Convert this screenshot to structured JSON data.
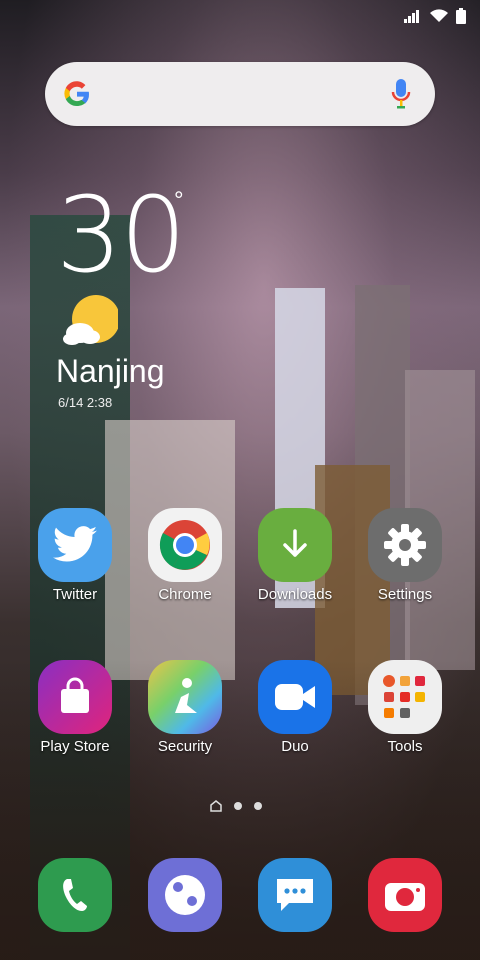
{
  "weather": {
    "temperature": "30",
    "degree_symbol": "°",
    "city": "Nanjing",
    "updated": "6/14 2:38"
  },
  "apps_row1": [
    {
      "label": "Twitter",
      "icon": "twitter-icon",
      "color": "#4aa1eb"
    },
    {
      "label": "Chrome",
      "icon": "chrome-icon",
      "color": "#f2f2f2"
    },
    {
      "label": "Downloads",
      "icon": "download-icon",
      "color": "#69ae3f"
    },
    {
      "label": "Settings",
      "icon": "gear-icon",
      "color": "#6d6d6d"
    }
  ],
  "apps_row2": [
    {
      "label": "Play Store",
      "icon": "shopping-bag-icon",
      "color": "#c6248c"
    },
    {
      "label": "Security",
      "icon": "security-icon",
      "color": "#56c5e8"
    },
    {
      "label": "Duo",
      "icon": "video-camera-icon",
      "color": "#1a73e8"
    },
    {
      "label": "Tools",
      "icon": "folder-icon",
      "color": "#efefef"
    }
  ],
  "dock": [
    {
      "icon": "phone-icon",
      "color": "#2e9b4f"
    },
    {
      "icon": "internet-icon",
      "color": "#6e6fd6"
    },
    {
      "icon": "messages-icon",
      "color": "#2f8fd8"
    },
    {
      "icon": "camera-icon",
      "color": "#e0283d"
    }
  ]
}
